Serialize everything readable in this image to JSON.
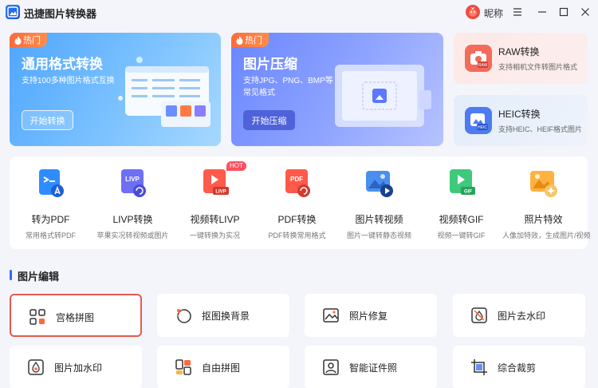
{
  "window": {
    "title": "迅捷图片转换器",
    "nickname": "昵称"
  },
  "hero": {
    "general": {
      "tag": "热门",
      "title": "通用格式转换",
      "desc": "支持100多种图片格式互换",
      "button": "开始转换"
    },
    "compress": {
      "tag": "热门",
      "title": "图片压缩",
      "desc": "支持JPG、PNG、BMP等常见格式",
      "button": "开始压缩"
    },
    "raw": {
      "title": "RAW转换",
      "desc": "支持相机文件转图片格式",
      "icon_text": "RAW"
    },
    "heic": {
      "title": "HEIC转换",
      "desc": "支持HEIC、HEIF格式图片",
      "icon_text": "HEIC"
    }
  },
  "tools": [
    {
      "name": "转为PDF",
      "desc": "常用格式转PDF",
      "icon": "pdf-convert-icon"
    },
    {
      "name": "LIVP转换",
      "desc": "苹果实况转视频或图片",
      "icon": "livp-icon",
      "icon_text": "LIVP"
    },
    {
      "name": "视频转LIVP",
      "desc": "一键转换为实况",
      "icon": "video-livp-icon",
      "icon_text": "LIVP",
      "badge": "HOT"
    },
    {
      "name": "PDF转换",
      "desc": "PDF转换常用格式",
      "icon": "pdf-icon",
      "icon_text": "PDF"
    },
    {
      "name": "图片转视频",
      "desc": "图片一键转静态视频",
      "icon": "image-video-icon"
    },
    {
      "name": "视频转GIF",
      "desc": "视频一键转GIF",
      "icon": "gif-icon",
      "icon_text": "GIF"
    },
    {
      "name": "照片特效",
      "desc": "人像加特效，生成图片/视频",
      "icon": "photo-effect-icon"
    }
  ],
  "section": {
    "title": "图片编辑"
  },
  "edit_tools": [
    {
      "label": "宫格拼图",
      "icon": "grid-icon"
    },
    {
      "label": "抠图换背景",
      "icon": "cutout-icon"
    },
    {
      "label": "照片修复",
      "icon": "photo-repair-icon"
    },
    {
      "label": "图片去水印",
      "icon": "remove-watermark-icon"
    },
    {
      "label": "图片加水印",
      "icon": "add-watermark-icon"
    },
    {
      "label": "自由拼图",
      "icon": "free-collage-icon"
    },
    {
      "label": "智能证件照",
      "icon": "id-photo-icon"
    },
    {
      "label": "综合裁剪",
      "icon": "crop-icon"
    }
  ],
  "colors": {
    "accent": "#2f6bff",
    "hot": "#ff6a3a",
    "active_border": "#e55a4f"
  }
}
